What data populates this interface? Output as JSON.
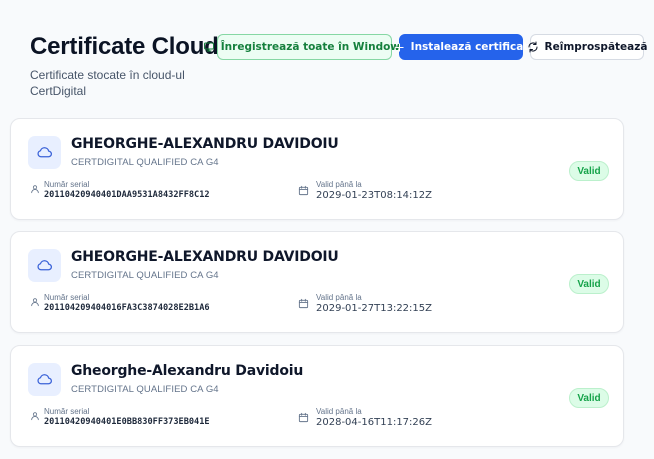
{
  "header": {
    "title": "Certificate Cloud",
    "subtitle": "Certificate stocate în cloud-ul CertDigital",
    "buttons": {
      "register_all": "Înregistrează toate în Windows",
      "install": "Instalează certificat",
      "refresh": "Reîmprospătează"
    }
  },
  "labels": {
    "serial": "Număr serial",
    "valid_until": "Valid până la"
  },
  "certificates": [
    {
      "owner": "GHEORGHE-ALEXANDRU DAVIDOIU",
      "issuer": "CERTDIGITAL QUALIFIED CA G4",
      "serial": "20110420940401DAA9531A8432FF8C12",
      "valid_until": "2029-01-23T08:14:12Z",
      "status": "Valid"
    },
    {
      "owner": "GHEORGHE-ALEXANDRU DAVIDOIU",
      "issuer": "CERTDIGITAL QUALIFIED CA G4",
      "serial": "201104209404016FA3C3874028E2B1A6",
      "valid_until": "2029-01-27T13:22:15Z",
      "status": "Valid"
    },
    {
      "owner": "Gheorghe-Alexandru Davidoiu",
      "issuer": "CERTDIGITAL QUALIFIED CA G4",
      "serial": "20110420940401E0BB830FF373EB041E",
      "valid_until": "2028-04-16T11:17:26Z",
      "status": "Valid"
    }
  ],
  "colors": {
    "accent": "#2563eb",
    "success": "#16a34a",
    "success_bg": "#dcfce7"
  },
  "icons": {
    "register": "monitor-icon",
    "install": "plus-icon",
    "refresh": "refresh-icon",
    "certificate": "cloud-icon",
    "serial": "user-icon",
    "date": "calendar-icon"
  }
}
